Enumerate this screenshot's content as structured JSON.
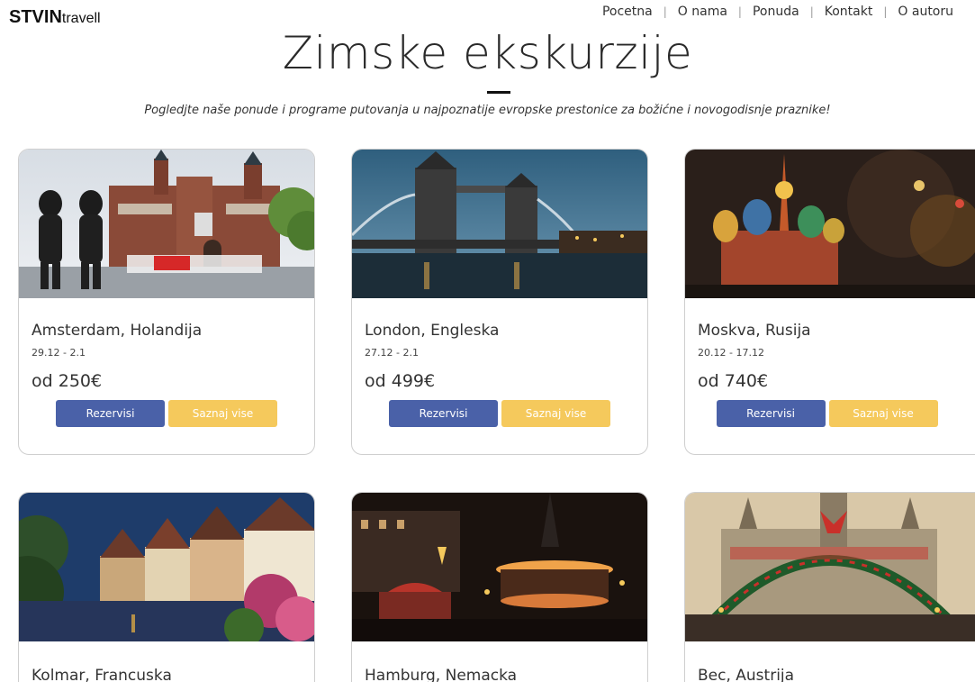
{
  "header": {
    "logo_bold": "STVIN",
    "logo_thin": "travell",
    "nav": [
      "Pocetna",
      "O nama",
      "Ponuda",
      "Kontakt",
      "O autoru"
    ]
  },
  "hero": {
    "title": "Zimske ekskurzije",
    "subtitle": "Pogledjte naše ponude i programe putovanja u najpoznatije evropske prestonice za božićne i novogodisnje praznike!"
  },
  "tours": [
    {
      "name": "Amsterdam, Holandija",
      "dates": "29.12 - 2.1",
      "price": "od 250€",
      "reserve_label": "Rezervisi",
      "more_label": "Saznaj vise"
    },
    {
      "name": "London, Engleska",
      "dates": "27.12 - 2.1",
      "price": "od 499€",
      "reserve_label": "Rezervisi",
      "more_label": "Saznaj vise"
    },
    {
      "name": "Moskva, Rusija",
      "dates": "20.12 - 17.12",
      "price": "od 740€",
      "reserve_label": "Rezervisi",
      "more_label": "Saznaj vise"
    },
    {
      "name": "Kolmar, Francuska"
    },
    {
      "name": "Hamburg, Nemacka"
    },
    {
      "name": "Bec, Austrija"
    }
  ],
  "colors": {
    "reserve_button": "#4a61a8",
    "more_button": "#f5c95c"
  }
}
